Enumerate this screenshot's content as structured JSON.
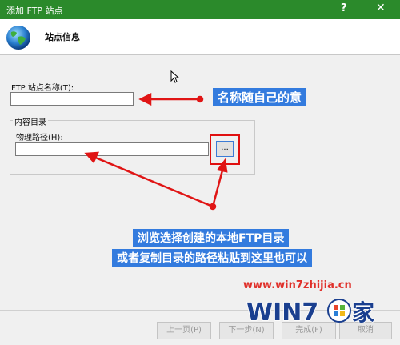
{
  "window": {
    "title": "添加 FTP 站点",
    "help": "?",
    "close": "✕"
  },
  "header": {
    "title": "站点信息"
  },
  "form": {
    "site_name_label": "FTP 站点名称(T):",
    "site_name_value": "",
    "content_dir_label": "内容目录",
    "physical_path_label": "物理路径(H):",
    "physical_path_value": "",
    "browse_label": "..."
  },
  "annotations": {
    "name_note": "名称随自己的意",
    "browse_note_line1": "浏览选择创建的本地FTP目录",
    "browse_note_line2": "或者复制目录的路径粘贴到这里也可以"
  },
  "footer": {
    "prev": "上一页(P)",
    "next": "下一步(N)",
    "finish": "完成(F)",
    "cancel": "取消"
  },
  "watermark": {
    "url": "www.win7zhijia.cn",
    "logo_text": "WIN7之家"
  }
}
